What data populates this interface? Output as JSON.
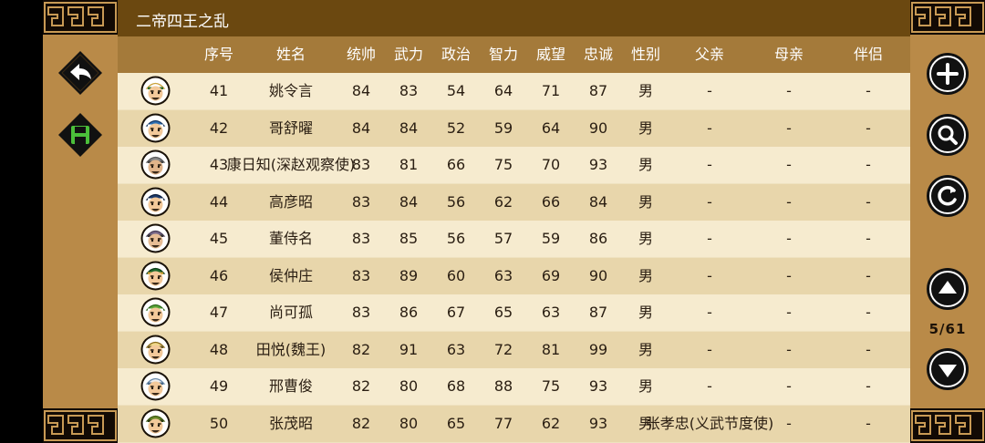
{
  "title": "二帝四王之乱",
  "headers": [
    "序号",
    "姓名",
    "统帅",
    "武力",
    "政治",
    "智力",
    "威望",
    "忠诚",
    "性别",
    "父亲",
    "母亲",
    "伴侣"
  ],
  "rows": [
    {
      "avatar": {
        "hat": "#ffffff",
        "trim": "#caa13a",
        "face": "#f3c99a",
        "band": "#2f6b2b"
      },
      "cells": [
        "41",
        "姚令言",
        "84",
        "83",
        "54",
        "64",
        "71",
        "87",
        "男",
        "-",
        "-",
        "-"
      ]
    },
    {
      "avatar": {
        "hat": "#2d6fb2",
        "trim": "#1a3a66",
        "face": "#f3c99a",
        "band": "#ffffff"
      },
      "cells": [
        "42",
        "哥舒曜",
        "84",
        "84",
        "52",
        "59",
        "64",
        "90",
        "男",
        "-",
        "-",
        "-"
      ]
    },
    {
      "avatar": {
        "hat": "#8a8a8a",
        "trim": "#5a5a5a",
        "face": "#e0b48a",
        "band": "#444444"
      },
      "cells": [
        "43",
        "康日知(深赵观察使)",
        "83",
        "81",
        "66",
        "75",
        "70",
        "93",
        "男",
        "-",
        "-",
        "-"
      ]
    },
    {
      "avatar": {
        "hat": "#1b3a6b",
        "trim": "#0e2040",
        "face": "#f3c99a",
        "band": "#ffffff"
      },
      "cells": [
        "44",
        "高彦昭",
        "83",
        "84",
        "56",
        "62",
        "66",
        "84",
        "男",
        "-",
        "-",
        "-"
      ]
    },
    {
      "avatar": {
        "hat": "#7a6a8a",
        "trim": "#4a3e58",
        "face": "#e7bd95",
        "band": "#333333"
      },
      "cells": [
        "45",
        "董侍名",
        "83",
        "85",
        "56",
        "57",
        "59",
        "86",
        "男",
        "-",
        "-",
        "-"
      ]
    },
    {
      "avatar": {
        "hat": "#1d6a2e",
        "trim": "#0e3d19",
        "face": "#f3c99a",
        "band": "#caa13a"
      },
      "cells": [
        "46",
        "侯仲庄",
        "83",
        "89",
        "60",
        "63",
        "69",
        "90",
        "男",
        "-",
        "-",
        "-"
      ]
    },
    {
      "avatar": {
        "hat": "#5aa63a",
        "trim": "#2f6b1d",
        "face": "#f3c99a",
        "band": "#ffffff"
      },
      "cells": [
        "47",
        "尚可孤",
        "83",
        "86",
        "67",
        "65",
        "63",
        "87",
        "男",
        "-",
        "-",
        "-"
      ]
    },
    {
      "avatar": {
        "hat": "#f0d98a",
        "trim": "#8a6a1a",
        "face": "#f3c99a",
        "band": "#6a5a2a"
      },
      "cells": [
        "48",
        "田悦(魏王)",
        "82",
        "91",
        "63",
        "72",
        "81",
        "99",
        "男",
        "-",
        "-",
        "-"
      ]
    },
    {
      "avatar": {
        "hat": "#eeeeee",
        "trim": "#6a8aaa",
        "face": "#f3c99a",
        "band": "#4a6a8a"
      },
      "cells": [
        "49",
        "邢曹俊",
        "82",
        "80",
        "68",
        "88",
        "75",
        "93",
        "男",
        "-",
        "-",
        "-"
      ]
    },
    {
      "avatar": {
        "hat": "#6a8a2a",
        "trim": "#3e5a14",
        "face": "#f3c99a",
        "band": "#2a3a10"
      },
      "cells": [
        "50",
        "张茂昭",
        "82",
        "80",
        "65",
        "77",
        "62",
        "93",
        "男",
        "张孝忠(义武节度使)",
        "-",
        "-"
      ]
    }
  ],
  "pager": {
    "text": "5/61"
  },
  "colors": {
    "title_bar": "#6b4810",
    "header": "#a47a3a",
    "row_light": "#f6ebcf",
    "row_dark": "#e8d6ab",
    "side_panel": "#b98a48"
  }
}
